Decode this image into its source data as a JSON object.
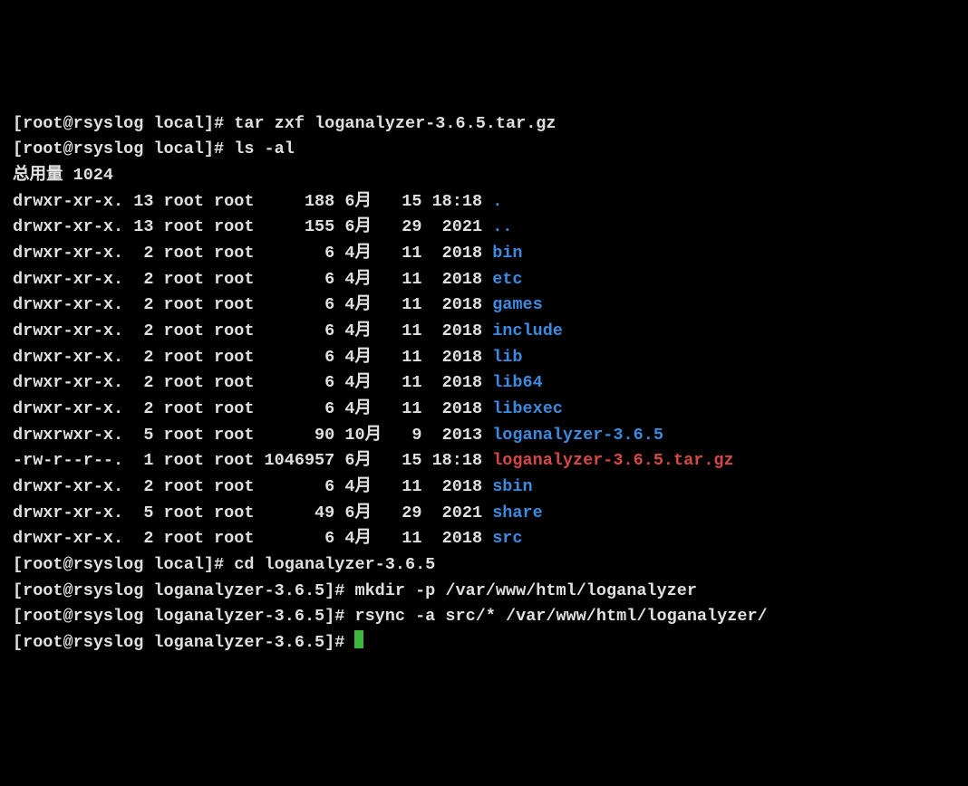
{
  "lines": [
    {
      "prompt": "[root@rsyslog local]# ",
      "cmd": "tar zxf loganalyzer-3.6.5.tar.gz",
      "after": ""
    },
    {
      "prompt": "[root@rsyslog local]# ",
      "cmd": "ls -al",
      "after": ""
    },
    {
      "raw": "总用量 1024"
    }
  ],
  "listing": [
    {
      "perm": "drwxr-xr-x.",
      "n": "13",
      "u": "root",
      "g": "root",
      "size": "188",
      "m": "6月",
      "d": "15",
      "t": "18:18",
      "name": ".",
      "kind": "dir"
    },
    {
      "perm": "drwxr-xr-x.",
      "n": "13",
      "u": "root",
      "g": "root",
      "size": "155",
      "m": "6月",
      "d": "29",
      "t": "2021",
      "name": "..",
      "kind": "dir"
    },
    {
      "perm": "drwxr-xr-x.",
      "n": " 2",
      "u": "root",
      "g": "root",
      "size": "6",
      "m": "4月",
      "d": "11",
      "t": "2018",
      "name": "bin",
      "kind": "dir"
    },
    {
      "perm": "drwxr-xr-x.",
      "n": " 2",
      "u": "root",
      "g": "root",
      "size": "6",
      "m": "4月",
      "d": "11",
      "t": "2018",
      "name": "etc",
      "kind": "dir"
    },
    {
      "perm": "drwxr-xr-x.",
      "n": " 2",
      "u": "root",
      "g": "root",
      "size": "6",
      "m": "4月",
      "d": "11",
      "t": "2018",
      "name": "games",
      "kind": "dir"
    },
    {
      "perm": "drwxr-xr-x.",
      "n": " 2",
      "u": "root",
      "g": "root",
      "size": "6",
      "m": "4月",
      "d": "11",
      "t": "2018",
      "name": "include",
      "kind": "dir"
    },
    {
      "perm": "drwxr-xr-x.",
      "n": " 2",
      "u": "root",
      "g": "root",
      "size": "6",
      "m": "4月",
      "d": "11",
      "t": "2018",
      "name": "lib",
      "kind": "dir"
    },
    {
      "perm": "drwxr-xr-x.",
      "n": " 2",
      "u": "root",
      "g": "root",
      "size": "6",
      "m": "4月",
      "d": "11",
      "t": "2018",
      "name": "lib64",
      "kind": "dir"
    },
    {
      "perm": "drwxr-xr-x.",
      "n": " 2",
      "u": "root",
      "g": "root",
      "size": "6",
      "m": "4月",
      "d": "11",
      "t": "2018",
      "name": "libexec",
      "kind": "dir"
    },
    {
      "perm": "drwxrwxr-x.",
      "n": " 5",
      "u": "root",
      "g": "root",
      "size": "90",
      "m": "10月",
      "d": " 9",
      "t": "2013",
      "name": "loganalyzer-3.6.5",
      "kind": "dir"
    },
    {
      "perm": "-rw-r--r--.",
      "n": " 1",
      "u": "root",
      "g": "root",
      "size": "1046957",
      "m": "6月",
      "d": "15",
      "t": "18:18",
      "name": "loganalyzer-3.6.5.tar.gz",
      "kind": "arch"
    },
    {
      "perm": "drwxr-xr-x.",
      "n": " 2",
      "u": "root",
      "g": "root",
      "size": "6",
      "m": "4月",
      "d": "11",
      "t": "2018",
      "name": "sbin",
      "kind": "dir"
    },
    {
      "perm": "drwxr-xr-x.",
      "n": " 5",
      "u": "root",
      "g": "root",
      "size": "49",
      "m": "6月",
      "d": "29",
      "t": "2021",
      "name": "share",
      "kind": "dir"
    },
    {
      "perm": "drwxr-xr-x.",
      "n": " 2",
      "u": "root",
      "g": "root",
      "size": "6",
      "m": "4月",
      "d": "11",
      "t": "2018",
      "name": "src",
      "kind": "dir"
    }
  ],
  "tail": [
    {
      "prompt": "[root@rsyslog local]# ",
      "cmd": "cd loganalyzer-3.6.5"
    },
    {
      "prompt": "[root@rsyslog loganalyzer-3.6.5]# ",
      "cmd": "mkdir -p /var/www/html/loganalyzer"
    },
    {
      "prompt": "[root@rsyslog loganalyzer-3.6.5]# ",
      "cmd": "rsync -a src/* /var/www/html/loganalyzer/"
    },
    {
      "prompt": "[root@rsyslog loganalyzer-3.6.5]# ",
      "cmd": ""
    }
  ],
  "columns": {
    "size_width": 7,
    "month_width": 4,
    "day_width": 2,
    "time_width": 5
  }
}
